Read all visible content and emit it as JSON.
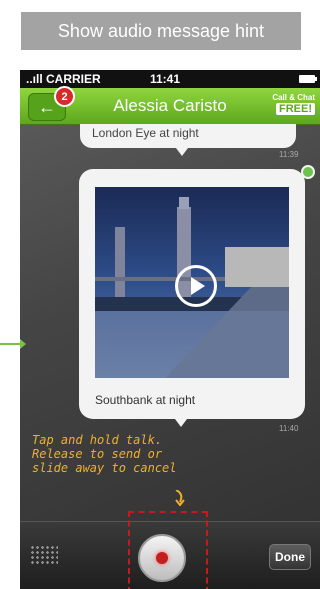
{
  "hint_banner": {
    "label": "Show audio message hint"
  },
  "status_bar": {
    "carrier": "..ıll CARRIER",
    "time": "11:41"
  },
  "nav": {
    "back_badge": "2",
    "title": "Alessia Caristo",
    "call_chat": "Call & Chat",
    "free": "FREE!"
  },
  "chat": {
    "message_1_text": "London Eye at night",
    "message_1_time": "11:39",
    "message_2_caption": "Southbank at night",
    "message_2_time": "11:40"
  },
  "annotation": {
    "text": "Tap and hold talk. Release to send or slide away to cancel"
  },
  "bottom_bar": {
    "done_label": "Done"
  },
  "colors": {
    "accent_green": "#5ea71d",
    "annotation": "#f0b02e",
    "highlight": "#c81a1a"
  }
}
